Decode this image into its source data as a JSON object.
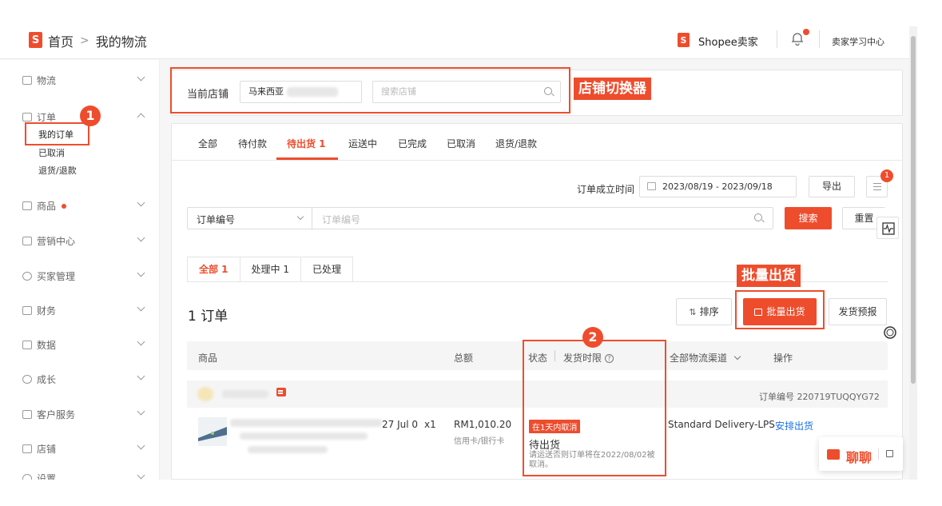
{
  "header": {
    "logo_char": "S",
    "home": "首页",
    "separator": ">",
    "page_title": "我的物流",
    "seller_label": "Shopee卖家",
    "learning_center": "卖家学习中心"
  },
  "sidebar": {
    "items": [
      {
        "label": "物流"
      },
      {
        "label": "订单"
      },
      {
        "label": "商品"
      },
      {
        "label": "营销中心"
      },
      {
        "label": "买家管理"
      },
      {
        "label": "财务"
      },
      {
        "label": "数据"
      },
      {
        "label": "成长"
      },
      {
        "label": "客户服务"
      },
      {
        "label": "店铺"
      },
      {
        "label": "设置"
      }
    ],
    "order_sub": [
      "我的订单",
      "已取消",
      "退货/退款"
    ]
  },
  "annotations": {
    "num1": "1",
    "num2": "2",
    "shop_switcher_label": "店铺切换器",
    "batch_ship_label": "批量出货"
  },
  "shop": {
    "label": "当前店铺",
    "current": "马来西亚",
    "search_placeholder": "搜索店铺"
  },
  "tabs": [
    "全部",
    "待付款",
    "待出货 1",
    "运送中",
    "已完成",
    "已取消",
    "退货/退款"
  ],
  "filters": {
    "date_label": "订单成立时间",
    "date_range": "2023/08/19 - 2023/09/18",
    "export": "导出",
    "menu_badge": "1",
    "search_type": "订单编号",
    "search_placeholder": "订单编号",
    "search_btn": "搜索",
    "reset_btn": "重置"
  },
  "sub_tabs": [
    "全部 1",
    "处理中 1",
    "已处理"
  ],
  "orders": {
    "count": "1 订单",
    "sort": "排序",
    "batch_ship": "批量出货",
    "ship_forecast": "发货预报"
  },
  "table": {
    "headers": {
      "product": "商品",
      "total": "总额",
      "status": "状态",
      "ship_deadline": "发货时限",
      "channel": "全部物流渠道",
      "action": "操作"
    },
    "order_number": "订单编号 220719TUQQYG72",
    "row": {
      "date_fragment": "27 Jul 0",
      "qty": "x1",
      "amount": "RM1,010.20",
      "payment": "信用卡/银行卡",
      "tag": "在1天内取消",
      "status": "待出货",
      "note": "请运送否则订单将在2022/08/02被取消。",
      "channel": "Standard Delivery-LPS",
      "action": "安排出货"
    }
  },
  "chat": {
    "label": "聊聊"
  },
  "colors": {
    "brand": "#ee4d2d",
    "link": "#1a73e8"
  }
}
